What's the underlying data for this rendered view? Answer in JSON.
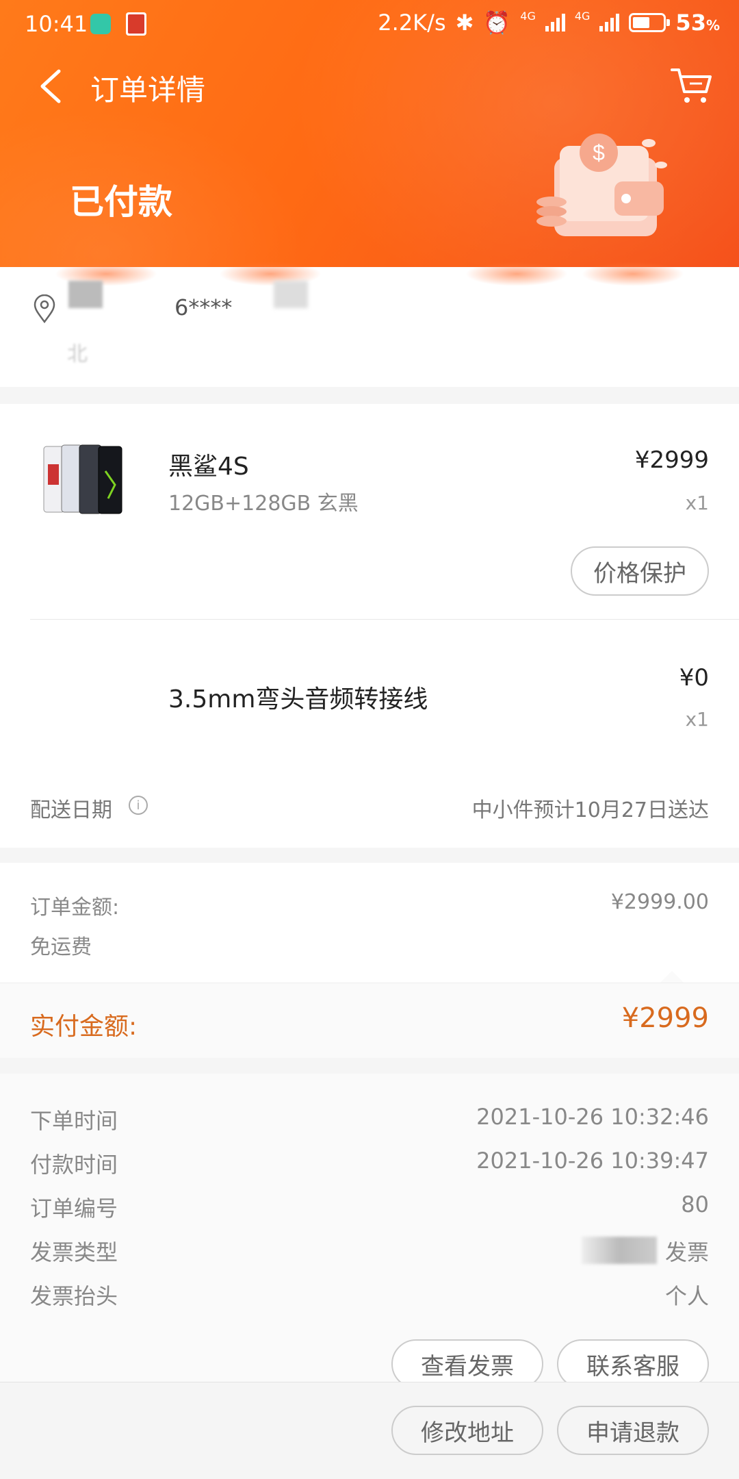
{
  "status_bar": {
    "time": "10:41",
    "net_speed": "2.2K/s",
    "net1": "4G",
    "net2": "4G",
    "battery": "53"
  },
  "header": {
    "title": "订单详情",
    "order_status": "已付款",
    "accent": "#ff6a14"
  },
  "address": {
    "phone_masked": "6****",
    "line2": "北"
  },
  "items": [
    {
      "name": "黑鲨4S",
      "spec": "12GB+128GB 玄黑",
      "price": "¥2999",
      "qty": "x1",
      "action": "价格保护"
    },
    {
      "name": "3.5mm弯头音频转接线",
      "price": "¥0",
      "qty": "x1"
    }
  ],
  "delivery": {
    "label": "配送日期",
    "value": "中小件预计10月27日送达"
  },
  "amounts": {
    "order_amount_label": "订单金额:",
    "order_amount_value": "¥2999.00",
    "shipping_label": "免运费",
    "paid_label": "实付金额:",
    "paid_value": "¥2999",
    "paid_color": "#d86a1e"
  },
  "meta": {
    "order_time_label": "下单时间",
    "order_time": "2021-10-26 10:32:46",
    "pay_time_label": "付款时间",
    "pay_time": "2021-10-26 10:39:47",
    "order_no_label": "订单编号",
    "order_no": "80",
    "invoice_type_label": "发票类型",
    "invoice_type": "发票",
    "invoice_title_label": "发票抬头",
    "invoice_title": "个人"
  },
  "actions": {
    "view_invoice": "查看发票",
    "contact_service": "联系客服",
    "modify_address": "修改地址",
    "refund": "申请退款"
  }
}
